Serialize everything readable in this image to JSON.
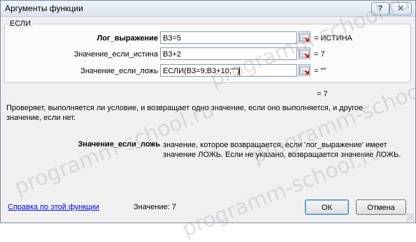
{
  "window": {
    "title": "Аргументы функции",
    "help_label": "?",
    "close_label": "✕"
  },
  "function_group": {
    "name": "ЕСЛИ",
    "args": [
      {
        "label": "Лог_выражение",
        "value": "B3=5",
        "result": "= ИСТИНА"
      },
      {
        "label": "Значение_если_истина",
        "value": "B3+2",
        "result": "= 7"
      },
      {
        "label": "Значение_если_ложь",
        "value": "ЕСЛИ(B3=9;B3+10;\"\")",
        "result": "= \"\""
      }
    ]
  },
  "formula_result": "= 7",
  "function_description": "Проверяет, выполняется ли условие, и возвращает одно значение, если оно выполняется, и другое значение, если нет.",
  "active_argument": {
    "name": "Значение_если_ложь",
    "description": "значение, которое возвращается, если 'лог_выражение' имеет значение ЛОЖЬ. Если не указано, возвращается значение ЛОЖЬ."
  },
  "footer": {
    "help_link": "Справка по этой функции",
    "value_label": "Значение:  7",
    "ok_label": "ОК",
    "cancel_label": "Отмена"
  },
  "watermark": "programm-school.ru",
  "icons": {
    "range_select": "range-select-icon"
  }
}
